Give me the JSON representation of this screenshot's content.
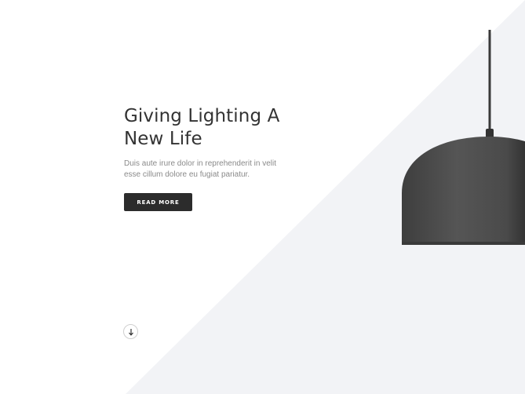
{
  "hero": {
    "headline_line1": "Giving Lighting A",
    "headline_line2": "New Life",
    "description": "Duis aute irure dolor in reprehenderit in velit esse cillum dolore eu fugiat pariatur.",
    "cta_label": "READ MORE"
  },
  "icons": {
    "scroll": "arrow-down-icon",
    "product": "pendant-lamp-image"
  },
  "colors": {
    "background": "#ffffff",
    "triangle": "#f2f3f6",
    "heading": "#333333",
    "body_text": "#8a8a8a",
    "button_bg": "#2c2c2c",
    "button_text": "#ffffff",
    "lamp": "#4a4a4a"
  }
}
